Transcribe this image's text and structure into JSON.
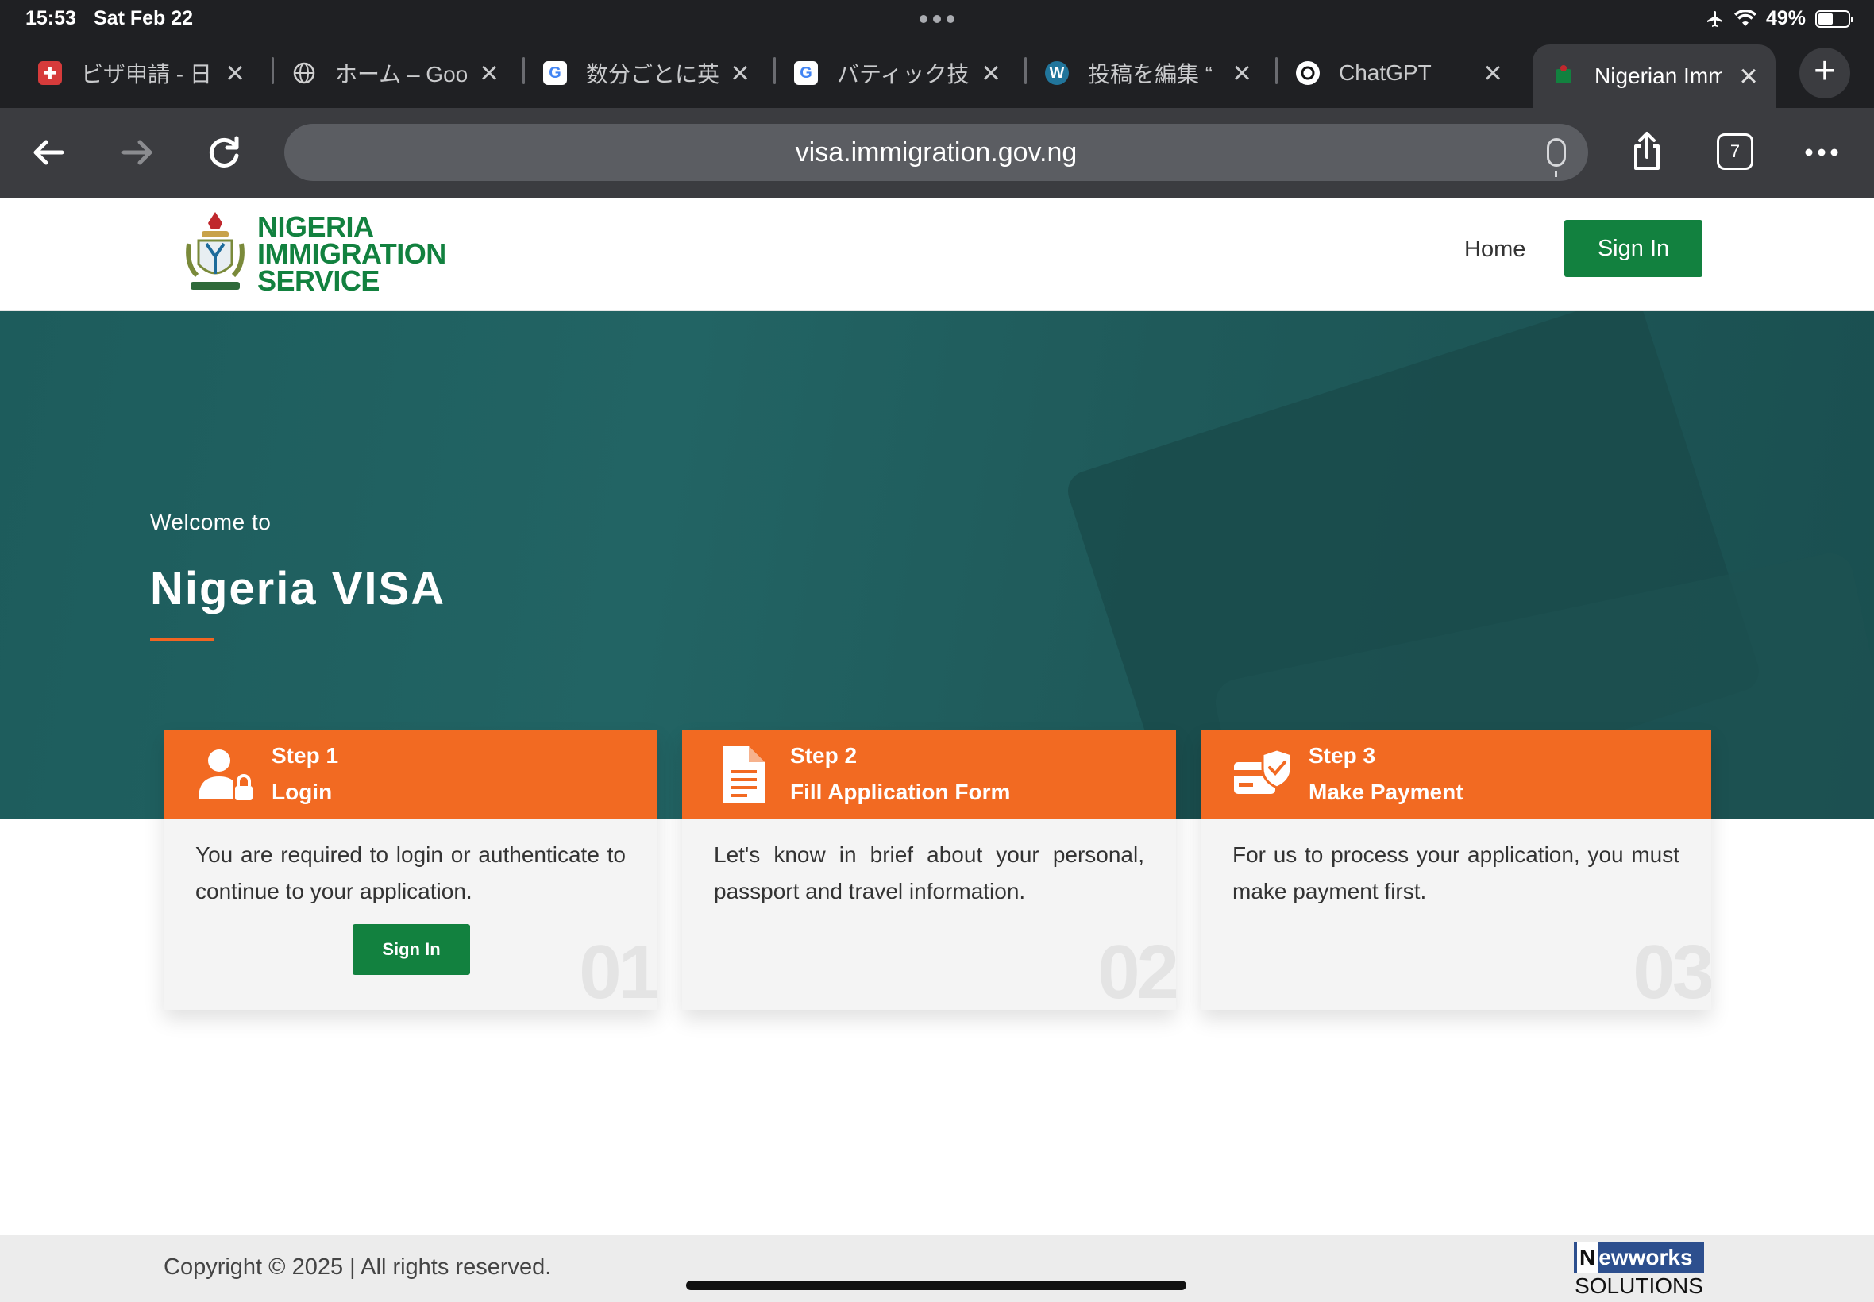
{
  "status_bar": {
    "time": "15:53",
    "date": "Sat Feb 22",
    "battery_percent": "49%",
    "battery_level": 0.49
  },
  "browser": {
    "tabs": [
      {
        "title": "ビザ申請 - 日",
        "icon": "japan-visa-favicon"
      },
      {
        "title": "ホーム – Goo",
        "icon": "globe-favicon"
      },
      {
        "title": "数分ごとに英",
        "icon": "google-favicon"
      },
      {
        "title": "バティック技",
        "icon": "google-favicon"
      },
      {
        "title": "投稿を編集 “",
        "icon": "wordpress-favicon"
      },
      {
        "title": "ChatGPT",
        "icon": "chatgpt-favicon"
      },
      {
        "title": "Nigerian Imm",
        "icon": "nigeria-crest-favicon",
        "active": true
      }
    ],
    "url": "visa.immigration.gov.ng",
    "tab_count": "7"
  },
  "site": {
    "logo_lines": [
      "NIGERIA",
      "IMMIGRATION",
      "SERVICE"
    ],
    "nav": {
      "home": "Home",
      "sign_in": "Sign In"
    },
    "hero": {
      "welcome": "Welcome to",
      "title": "Nigeria VISA"
    },
    "steps": [
      {
        "step": "Step 1",
        "name": "Login",
        "icon": "user-lock-icon",
        "text": "You are required to login or authenticate to continue to your application.",
        "button": "Sign In",
        "number": "01"
      },
      {
        "step": "Step 2",
        "name": "Fill Application Form",
        "icon": "document-icon",
        "text": "Let's know in brief about your personal, passport and travel information.",
        "number": "02"
      },
      {
        "step": "Step 3",
        "name": "Make Payment",
        "icon": "card-shield-icon",
        "text": "For us to process your application, you must make payment first.",
        "number": "03"
      }
    ],
    "footer": {
      "copyright": "Copyright © 2025 | All rights reserved.",
      "brand_initial": "N",
      "brand_rest": "ewworks",
      "brand_sub": "SOLUTIONS"
    }
  },
  "colors": {
    "brand_green": "#12813f",
    "step_orange": "#f26a22",
    "hero_teal": "#226464"
  }
}
